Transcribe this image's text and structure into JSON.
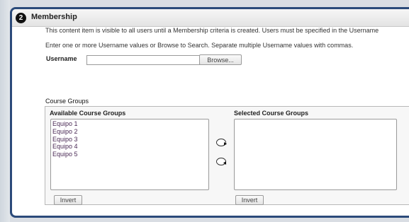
{
  "step": {
    "number": "2",
    "title": "Membership"
  },
  "description": {
    "line1": "This content item is visible to all users until a Membership criteria is created. Users must be specified in the Username",
    "line2": "Enter one or more Username values or Browse to Search. Separate multiple Username values with commas."
  },
  "username": {
    "label": "Username",
    "value": "",
    "browse_label": "Browse..."
  },
  "course_groups": {
    "heading": "Course Groups",
    "available": {
      "label": "Available Course Groups",
      "items": [
        "Equipo 1",
        "Equipo 2",
        "Equipo 3",
        "Equipo 4",
        "Equipo 5"
      ],
      "invert_label": "Invert"
    },
    "selected": {
      "label": "Selected Course Groups",
      "items": [],
      "invert_label": "Invert"
    },
    "move_right_icon": "arrow-right-circle-icon",
    "move_left_icon": "arrow-left-circle-icon"
  },
  "colors": {
    "frame": "#2b4a7a",
    "list_text": "#4a2a55"
  }
}
